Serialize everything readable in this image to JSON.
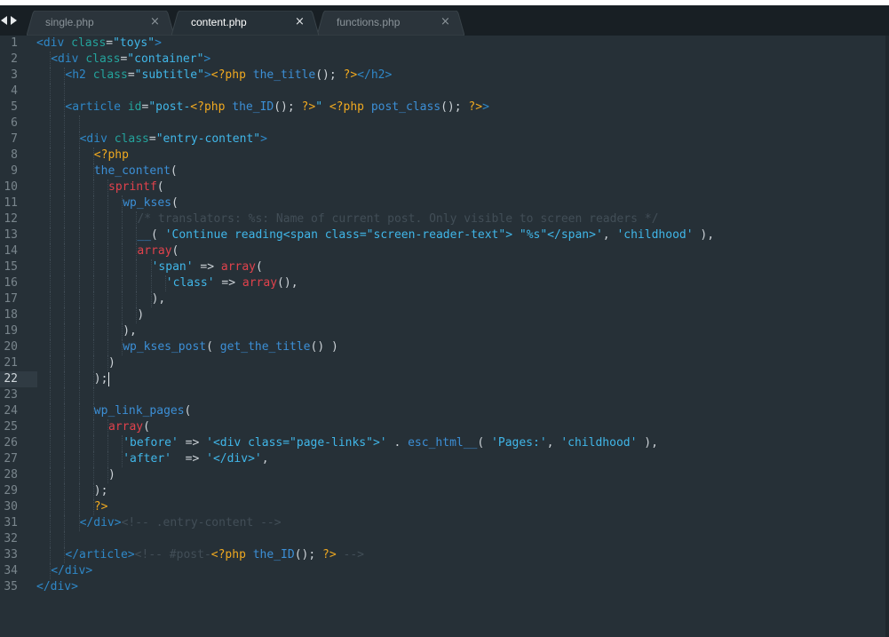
{
  "colors": {
    "background": "#263037",
    "tab_bar": "#181f24",
    "active_tab": "#263037",
    "inactive_tab": "#2b343b",
    "tag": "#2f88c8",
    "attribute": "#24a39c",
    "string": "#40b6e8",
    "php_delimiter": "#f0a920",
    "function": "#3c8fd6",
    "keyword": "#e0424c",
    "comment": "#424e57",
    "plain": "#cdd3d8"
  },
  "icons": {
    "nav_left": "caret-left-icon",
    "nav_right": "caret-right-icon",
    "close": "close-icon"
  },
  "tabs": [
    {
      "label": "single.php",
      "close": "×",
      "active": false
    },
    {
      "label": "content.php",
      "close": "×",
      "active": true
    },
    {
      "label": "functions.php",
      "close": "×",
      "active": false
    }
  ],
  "editor": {
    "active_line": 22,
    "lines": [
      {
        "num": "1",
        "indent": 0,
        "tokens": [
          [
            "tag",
            "<div "
          ],
          [
            "attr",
            "class"
          ],
          [
            "p",
            "="
          ],
          [
            "str",
            "\"toys\""
          ],
          [
            "tag",
            ">"
          ]
        ]
      },
      {
        "num": "2",
        "indent": 1,
        "tokens": [
          [
            "tag",
            "<div "
          ],
          [
            "attr",
            "class"
          ],
          [
            "p",
            "="
          ],
          [
            "str",
            "\"container\""
          ],
          [
            "tag",
            ">"
          ]
        ]
      },
      {
        "num": "3",
        "indent": 2,
        "tokens": [
          [
            "tag",
            "<h2 "
          ],
          [
            "attr",
            "class"
          ],
          [
            "p",
            "="
          ],
          [
            "str",
            "\"subtitle\""
          ],
          [
            "tag",
            ">"
          ],
          [
            "php",
            "<?php"
          ],
          [
            "p",
            " "
          ],
          [
            "fn",
            "the_title"
          ],
          [
            "p",
            "(); "
          ],
          [
            "php",
            "?>"
          ],
          [
            "tag",
            "</h2>"
          ]
        ]
      },
      {
        "num": "4",
        "indent": 2,
        "tokens": []
      },
      {
        "num": "5",
        "indent": 2,
        "tokens": [
          [
            "tag",
            "<article "
          ],
          [
            "attr",
            "id"
          ],
          [
            "p",
            "="
          ],
          [
            "str",
            "\"post-"
          ],
          [
            "php",
            "<?php"
          ],
          [
            "p",
            " "
          ],
          [
            "fn",
            "the_ID"
          ],
          [
            "p",
            "(); "
          ],
          [
            "php",
            "?>"
          ],
          [
            "str",
            "\""
          ],
          [
            "p",
            " "
          ],
          [
            "php",
            "<?php"
          ],
          [
            "p",
            " "
          ],
          [
            "fn",
            "post_class"
          ],
          [
            "p",
            "(); "
          ],
          [
            "php",
            "?>"
          ],
          [
            "tag",
            ">"
          ]
        ]
      },
      {
        "num": "6",
        "indent": 3,
        "tokens": []
      },
      {
        "num": "7",
        "indent": 3,
        "tokens": [
          [
            "tag",
            "<div "
          ],
          [
            "attr",
            "class"
          ],
          [
            "p",
            "="
          ],
          [
            "str",
            "\"entry-content\""
          ],
          [
            "tag",
            ">"
          ]
        ]
      },
      {
        "num": "8",
        "indent": 4,
        "tokens": [
          [
            "php",
            "<?php"
          ]
        ]
      },
      {
        "num": "9",
        "indent": 4,
        "tokens": [
          [
            "fn",
            "the_content"
          ],
          [
            "p",
            "("
          ]
        ]
      },
      {
        "num": "10",
        "indent": 5,
        "tokens": [
          [
            "kw",
            "sprintf"
          ],
          [
            "p",
            "("
          ]
        ]
      },
      {
        "num": "11",
        "indent": 6,
        "tokens": [
          [
            "fn",
            "wp_kses"
          ],
          [
            "p",
            "("
          ]
        ]
      },
      {
        "num": "12",
        "indent": 7,
        "tokens": [
          [
            "com",
            "/* translators: %s: Name of current post. Only visible to screen readers */"
          ]
        ]
      },
      {
        "num": "13",
        "indent": 7,
        "tokens": [
          [
            "fn",
            "__"
          ],
          [
            "p",
            "( "
          ],
          [
            "str",
            "'Continue reading<span class=\"screen-reader-text\"> \"%s\"</span>'"
          ],
          [
            "p",
            ", "
          ],
          [
            "str",
            "'childhood'"
          ],
          [
            "p",
            " ),"
          ]
        ]
      },
      {
        "num": "14",
        "indent": 7,
        "tokens": [
          [
            "kw",
            "array"
          ],
          [
            "p",
            "("
          ]
        ]
      },
      {
        "num": "15",
        "indent": 8,
        "tokens": [
          [
            "str",
            "'span'"
          ],
          [
            "p",
            " => "
          ],
          [
            "kw",
            "array"
          ],
          [
            "p",
            "("
          ]
        ]
      },
      {
        "num": "16",
        "indent": 9,
        "tokens": [
          [
            "str",
            "'class'"
          ],
          [
            "p",
            " => "
          ],
          [
            "kw",
            "array"
          ],
          [
            "p",
            "(),"
          ]
        ]
      },
      {
        "num": "17",
        "indent": 8,
        "tokens": [
          [
            "p",
            "),"
          ]
        ]
      },
      {
        "num": "18",
        "indent": 7,
        "tokens": [
          [
            "p",
            ")"
          ]
        ]
      },
      {
        "num": "19",
        "indent": 6,
        "tokens": [
          [
            "p",
            "),"
          ]
        ]
      },
      {
        "num": "20",
        "indent": 6,
        "tokens": [
          [
            "fn",
            "wp_kses_post"
          ],
          [
            "p",
            "( "
          ],
          [
            "fn",
            "get_the_title"
          ],
          [
            "p",
            "() )"
          ]
        ]
      },
      {
        "num": "21",
        "indent": 5,
        "tokens": [
          [
            "p",
            ")"
          ]
        ]
      },
      {
        "num": "22",
        "indent": 4,
        "tokens": [
          [
            "p",
            ");"
          ]
        ]
      },
      {
        "num": "23",
        "indent": 4,
        "tokens": []
      },
      {
        "num": "24",
        "indent": 4,
        "tokens": [
          [
            "fn",
            "wp_link_pages"
          ],
          [
            "p",
            "("
          ]
        ]
      },
      {
        "num": "25",
        "indent": 5,
        "tokens": [
          [
            "kw",
            "array"
          ],
          [
            "p",
            "("
          ]
        ]
      },
      {
        "num": "26",
        "indent": 6,
        "tokens": [
          [
            "str",
            "'before'"
          ],
          [
            "p",
            " => "
          ],
          [
            "str",
            "'<div class=\"page-links\">'"
          ],
          [
            "p",
            " . "
          ],
          [
            "fn",
            "esc_html__"
          ],
          [
            "p",
            "( "
          ],
          [
            "str",
            "'Pages:'"
          ],
          [
            "p",
            ", "
          ],
          [
            "str",
            "'childhood'"
          ],
          [
            "p",
            " ),"
          ]
        ]
      },
      {
        "num": "27",
        "indent": 6,
        "tokens": [
          [
            "str",
            "'after'"
          ],
          [
            "p",
            "  => "
          ],
          [
            "str",
            "'</div>'"
          ],
          [
            "p",
            ","
          ]
        ]
      },
      {
        "num": "28",
        "indent": 5,
        "tokens": [
          [
            "p",
            ")"
          ]
        ]
      },
      {
        "num": "29",
        "indent": 4,
        "tokens": [
          [
            "p",
            ");"
          ]
        ]
      },
      {
        "num": "30",
        "indent": 4,
        "tokens": [
          [
            "php",
            "?>"
          ]
        ]
      },
      {
        "num": "31",
        "indent": 3,
        "tokens": [
          [
            "tag",
            "</div>"
          ],
          [
            "com",
            "<!-- .entry-content -->"
          ]
        ]
      },
      {
        "num": "32",
        "indent": 2,
        "tokens": []
      },
      {
        "num": "33",
        "indent": 2,
        "tokens": [
          [
            "tag",
            "</article>"
          ],
          [
            "com",
            "<!-- #post-"
          ],
          [
            "php",
            "<?php"
          ],
          [
            "p",
            " "
          ],
          [
            "fn",
            "the_ID"
          ],
          [
            "p",
            "(); "
          ],
          [
            "php",
            "?>"
          ],
          [
            "com",
            " -->"
          ]
        ]
      },
      {
        "num": "34",
        "indent": 1,
        "tokens": [
          [
            "tag",
            "</div>"
          ]
        ]
      },
      {
        "num": "35",
        "indent": 0,
        "tokens": [
          [
            "tag",
            "</div>"
          ]
        ]
      }
    ]
  }
}
